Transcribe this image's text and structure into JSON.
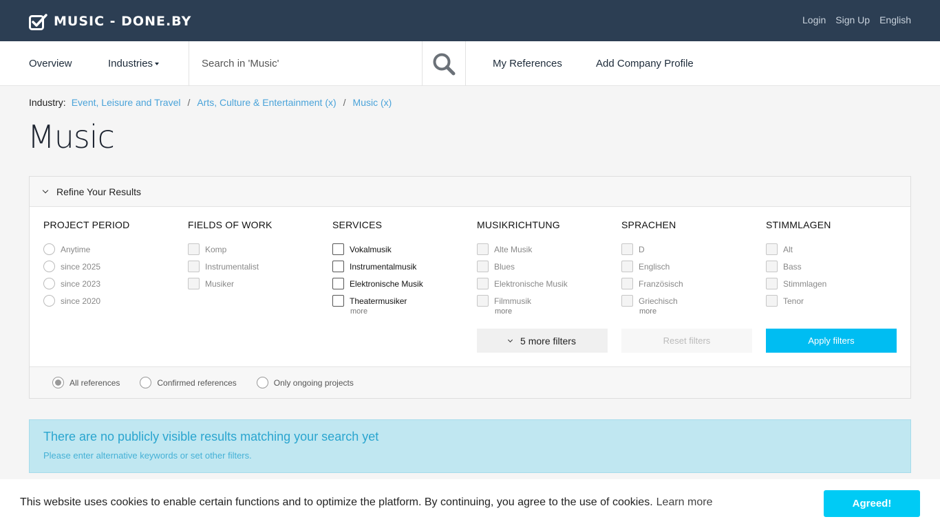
{
  "header": {
    "brand": "MUSIC - DONE.BY",
    "links": [
      "Login",
      "Sign Up",
      "English"
    ]
  },
  "nav": {
    "overview": "Overview",
    "industries": "Industries",
    "search_placeholder": "Search in 'Music'",
    "my_references": "My References",
    "add_company_profile": "Add Company Profile"
  },
  "breadcrumb": {
    "label": "Industry:",
    "items": [
      "Event, Leisure and Travel",
      "Arts, Culture & Entertainment (x)",
      "Music (x)"
    ],
    "separator": "/"
  },
  "page_title": "Music",
  "refine": {
    "title": "Refine Your Results",
    "columns": [
      {
        "heading": "PROJECT PERIOD",
        "options": [
          "Anytime",
          "since 2025",
          "since 2023",
          "since 2020"
        ]
      },
      {
        "heading": "FIELDS OF WORK",
        "options": [
          "Komp",
          "Instrumentalist",
          "Musiker"
        ]
      },
      {
        "heading": "SERVICES",
        "options": [
          "Vokalmusik",
          "Instrumentalmusik",
          "Elektronische Musik",
          "Theatermusiker"
        ],
        "more": "more"
      },
      {
        "heading": "MUSIKRICHTUNG",
        "options": [
          "Alte Musik",
          "Blues",
          "Elektronische Musik",
          "Filmmusik"
        ],
        "more": "more"
      },
      {
        "heading": "SPRACHEN",
        "options": [
          "D",
          "Englisch",
          "Französisch",
          "Griechisch"
        ],
        "more": "more"
      },
      {
        "heading": "STIMMLAGEN",
        "options": [
          "Alt",
          "Bass",
          "Stimmlagen",
          "Tenor"
        ]
      }
    ],
    "more_filters": "5 more filters",
    "reset": "Reset filters",
    "apply": "Apply filters",
    "reference_options": [
      "All references",
      "Confirmed references",
      "Only ongoing projects"
    ],
    "selected_reference": "All references"
  },
  "alert": {
    "title": "There are no publicly visible results matching your search yet",
    "text": "Please enter alternative keywords or set other filters."
  },
  "cookie": {
    "text": "This website uses cookies to enable certain functions and to optimize the platform. By continuing, you agree to the use of cookies.",
    "link": "Learn more",
    "button": "Agreed!"
  },
  "colors": {
    "topbar": "#2c3e53",
    "link": "#4aa3d9",
    "apply": "#00bdf2",
    "cookie_button": "#00cbf5",
    "alert_bg": "#c0e7f1"
  }
}
